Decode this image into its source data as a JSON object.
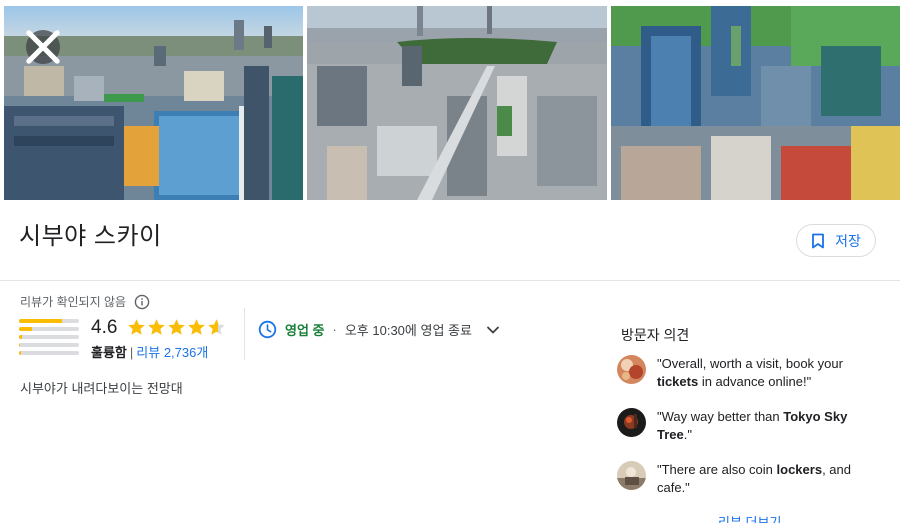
{
  "place": {
    "title": "시부야 스카이",
    "save_label": "저장",
    "description": "시부야가 내려다보이는 전망대"
  },
  "photos": [
    {
      "name": "photo-shibuya-crossing-aerial"
    },
    {
      "name": "photo-city-park-aerial"
    },
    {
      "name": "photo-city-buildings-aerial"
    }
  ],
  "rating": {
    "note": "리뷰가 확인되지 않음",
    "value": "4.6",
    "stars": 4.6,
    "label": "훌륭함",
    "separator": "|",
    "reviews_link": "리뷰 2,736개",
    "distribution": [
      0.72,
      0.22,
      0.05,
      0.02,
      0.03
    ]
  },
  "hours": {
    "status": "영업 중",
    "separator": "·",
    "detail": "오후 10:30에 영업 종료"
  },
  "opinions": {
    "title": "방문자 의견",
    "items": [
      {
        "before": "\"Overall, worth a visit, book your ",
        "bold": "tickets",
        "after": " in advance online!\""
      },
      {
        "before": "\"Way way better than ",
        "bold": "Tokyo Sky Tree",
        "after": ".\""
      },
      {
        "before": "\"There are also coin ",
        "bold": "lockers",
        "after": ", and cafe.\""
      }
    ],
    "more_label": "리뷰 더보기"
  },
  "colors": {
    "accent": "#1a73e8",
    "star": "#fbbc04",
    "open": "#188038"
  },
  "icons": [
    "close-icon",
    "bookmark-icon",
    "info-icon",
    "clock-icon",
    "chevron-down-icon",
    "star-icon"
  ]
}
